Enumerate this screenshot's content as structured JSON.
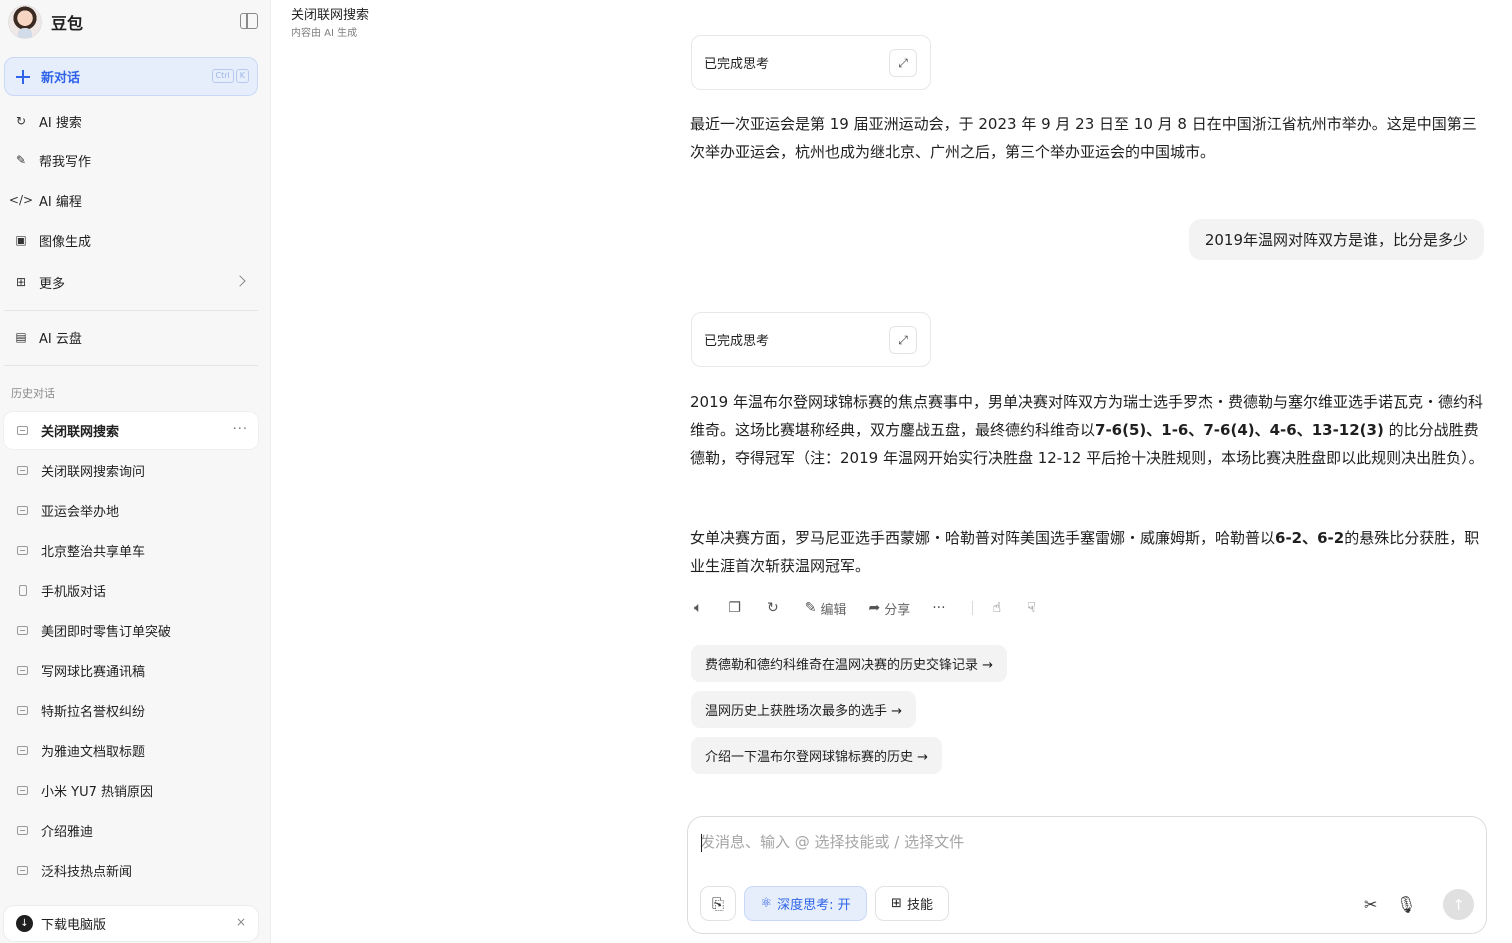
{
  "sidebar": {
    "brand": "豆包",
    "new_chat": {
      "label": "新对话",
      "shortcut": [
        "Ctrl",
        "K"
      ]
    },
    "nav": [
      {
        "label": "AI 搜索",
        "icon": "search-icon"
      },
      {
        "label": "帮我写作",
        "icon": "pen-icon"
      },
      {
        "label": "AI 编程",
        "icon": "code-icon"
      },
      {
        "label": "图像生成",
        "icon": "image-icon"
      },
      {
        "label": "更多",
        "icon": "grid-icon"
      }
    ],
    "cloud": {
      "label": "AI 云盘",
      "icon": "cloud-folder-icon"
    },
    "history_title": "历史对话",
    "history": [
      {
        "label": "关闭联网搜索",
        "active": true
      },
      {
        "label": "关闭联网搜索询问"
      },
      {
        "label": "亚运会举办地"
      },
      {
        "label": "北京整治共享单车"
      },
      {
        "label": "手机版对话",
        "icon": "phone-icon"
      },
      {
        "label": "美团即时零售订单突破"
      },
      {
        "label": "写网球比赛通讯稿"
      },
      {
        "label": "特斯拉名誉权纠纷"
      },
      {
        "label": "为雅迪文档取标题"
      },
      {
        "label": "小米 YU7 热销原因"
      },
      {
        "label": "介绍雅迪"
      },
      {
        "label": "泛科技热点新闻"
      }
    ],
    "download": {
      "label": "下载电脑版",
      "close": "×"
    }
  },
  "header": {
    "title": "关闭联网搜索",
    "subtitle": "内容由 AI 生成"
  },
  "chat": {
    "think_label": "已完成思考",
    "answer1": "最近一次亚运会是第 19 届亚洲运动会，于 2023 年 9 月 23 日至 10 月 8 日在中国浙江省杭州市举办。这是中国第三次举办亚运会，杭州也成为继北京、广州之后，第三个举办亚运会的中国城市。",
    "user_question": "2019年温网对阵双方是谁，比分是多少",
    "answer2_p1": {
      "a": "2019 年温布尔登网球锦标赛的焦点赛事中，男单决赛对阵双方为瑞士选手罗杰・费德勒与塞尔维亚选手诺瓦克・德约科维奇。这场比赛堪称经典，双方鏖战五盘，最终德约科维奇以",
      "score": "7-6(5)、1-6、7-6(4)、4-6、13-12(3)",
      "b": " 的比分战胜费德勒，夺得冠军（注：2019 年温网开始实行决胜盘 12-12 平后抢十决胜规则，本场比赛决胜盘即以此规则决出胜负）。"
    },
    "answer2_p2": {
      "a": "女单决赛方面，罗马尼亚选手西蒙娜・哈勒普对阵美国选手塞雷娜・威廉姆斯，哈勒普以",
      "score": "6-2、6-2",
      "b": "的悬殊比分获胜，职业生涯首次斩获温网冠军。"
    },
    "actions": {
      "edit": "编辑",
      "share": "分享"
    },
    "suggestions": [
      "费德勒和德约科维奇在温网决赛的历史交锋记录 →",
      "温网历史上获胜场次最多的选手 →",
      "介绍一下温布尔登网球锦标赛的历史 →"
    ]
  },
  "input": {
    "placeholder": "发消息、输入 @ 选择技能或 / 选择文件",
    "deep_think": "深度思考: 开",
    "skill": "技能"
  }
}
